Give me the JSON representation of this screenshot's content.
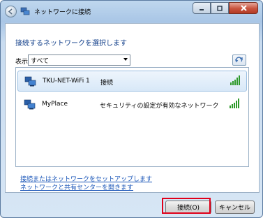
{
  "window": {
    "title": "ネットワークに接続",
    "controls": {
      "minimize": "minimize",
      "maximize": "maximize",
      "close": "close"
    }
  },
  "main": {
    "heading": "接続するネットワークを選択します",
    "filter": {
      "label": "表示",
      "selected": "すべて"
    },
    "networks": [
      {
        "name": "TKU-NET-WiFi 1",
        "status": "接続",
        "selected": true,
        "signal_bars": 5
      },
      {
        "name": "MyPlace",
        "status": "セキュリティの設定が有効なネットワーク",
        "selected": false,
        "signal_bars": 5
      }
    ],
    "links": [
      "接続またはネットワークをセットアップします",
      "ネットワークと共有センターを開きます"
    ]
  },
  "footer": {
    "connect_label": "接続(O)",
    "cancel_label": "キャンセル"
  },
  "colors": {
    "accent": "#0e3c88",
    "link": "#1a56b8",
    "highlight": "#e0001a",
    "signal": "#2e9a2a"
  }
}
